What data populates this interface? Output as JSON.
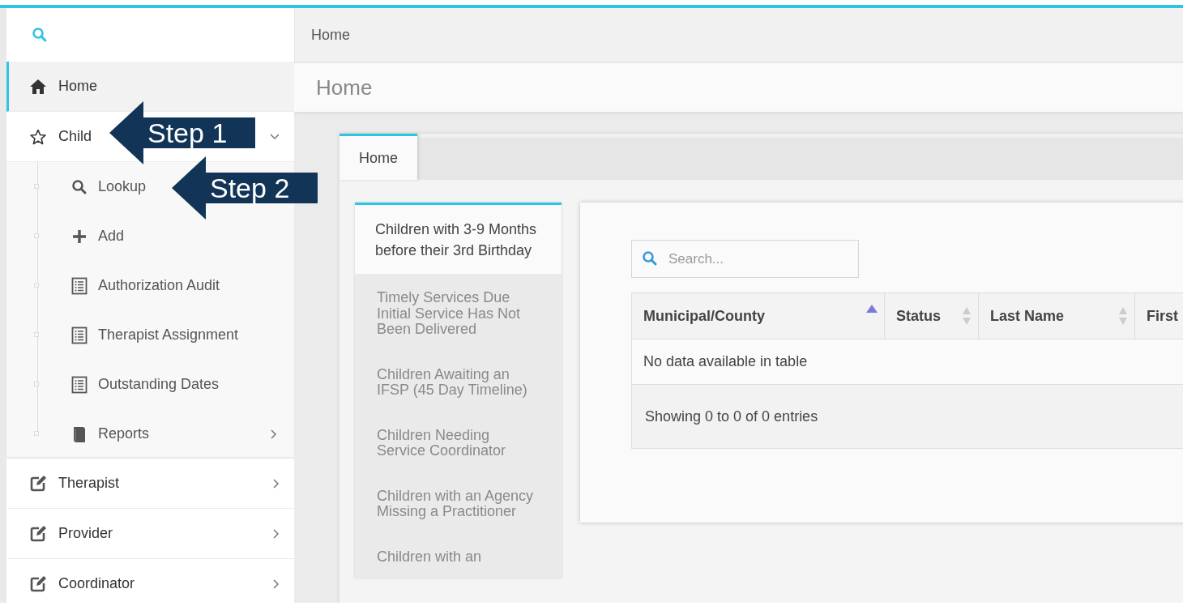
{
  "sidebar": {
    "items": [
      {
        "label": "Home",
        "kind": "link",
        "selected": true
      },
      {
        "label": "Child",
        "kind": "group",
        "selected": false,
        "expanded": true,
        "children": [
          {
            "label": "Lookup",
            "kind": "link",
            "selected": false
          },
          {
            "label": "Add",
            "kind": "link",
            "selected": false
          },
          {
            "label": "Authorization Audit",
            "kind": "link",
            "selected": false
          },
          {
            "label": "Therapist Assignment",
            "kind": "link",
            "selected": false
          },
          {
            "label": "Outstanding Dates",
            "kind": "link",
            "selected": false
          },
          {
            "label": "Reports",
            "kind": "group",
            "selected": false,
            "expanded": false
          }
        ]
      },
      {
        "label": "Therapist",
        "kind": "group",
        "selected": false,
        "expanded": false
      },
      {
        "label": "Provider",
        "kind": "group",
        "selected": false,
        "expanded": false
      },
      {
        "label": "Coordinator",
        "kind": "group",
        "selected": false,
        "expanded": false
      }
    ]
  },
  "breadcrumb": "Home",
  "page_title": "Home",
  "tabs": [
    {
      "label": "Home",
      "selected": true
    }
  ],
  "report_list": [
    {
      "label": "Children with 3-9 Months before their 3rd Birthday",
      "selected": true
    },
    {
      "label": "Timely Services Due Initial Service Has Not Been Delivered",
      "selected": false
    },
    {
      "label": "Children Awaiting an IFSP (45 Day Timeline)",
      "selected": false
    },
    {
      "label": "Children Needing Service Coordinator",
      "selected": false
    },
    {
      "label": "Children with an Agency Missing a Practitioner",
      "selected": false
    },
    {
      "label": "Children with an",
      "selected": false
    }
  ],
  "table": {
    "search": {
      "placeholder": "Search..."
    },
    "columns": [
      {
        "label": "Municipal/County",
        "sorted": true
      },
      {
        "label": "Status",
        "sorted": false
      },
      {
        "label": "Last Name",
        "sorted": false
      },
      {
        "label": "First"
      }
    ],
    "empty_message": "No data available in table",
    "info": "Showing 0 to 0 of 0 entries"
  },
  "annotations": [
    {
      "label": "Step 1"
    },
    {
      "label": "Step 2"
    }
  ]
}
